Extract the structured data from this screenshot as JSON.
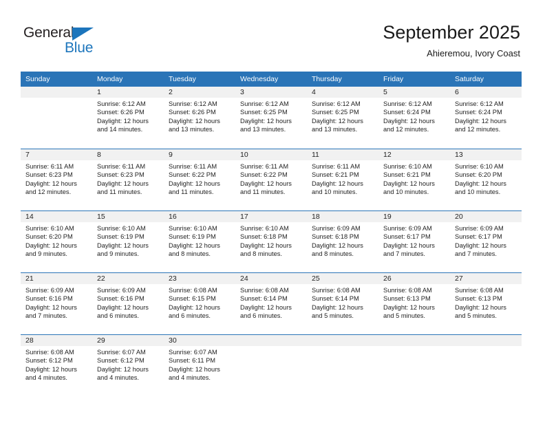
{
  "brand": {
    "name_part1": "General",
    "name_part2": "Blue",
    "accent_color": "#1c75bc"
  },
  "header": {
    "title": "September 2025",
    "subtitle": "Ahieremou, Ivory Coast"
  },
  "calendar": {
    "header_bg_color": "#2a74b7",
    "day_band_color": "#f1f1f1",
    "weekdays": [
      "Sunday",
      "Monday",
      "Tuesday",
      "Wednesday",
      "Thursday",
      "Friday",
      "Saturday"
    ],
    "weeks": [
      [
        {
          "day": "",
          "sunrise": "",
          "sunset": "",
          "daylight1": "",
          "daylight2": ""
        },
        {
          "day": "1",
          "sunrise": "Sunrise: 6:12 AM",
          "sunset": "Sunset: 6:26 PM",
          "daylight1": "Daylight: 12 hours",
          "daylight2": "and 14 minutes."
        },
        {
          "day": "2",
          "sunrise": "Sunrise: 6:12 AM",
          "sunset": "Sunset: 6:26 PM",
          "daylight1": "Daylight: 12 hours",
          "daylight2": "and 13 minutes."
        },
        {
          "day": "3",
          "sunrise": "Sunrise: 6:12 AM",
          "sunset": "Sunset: 6:25 PM",
          "daylight1": "Daylight: 12 hours",
          "daylight2": "and 13 minutes."
        },
        {
          "day": "4",
          "sunrise": "Sunrise: 6:12 AM",
          "sunset": "Sunset: 6:25 PM",
          "daylight1": "Daylight: 12 hours",
          "daylight2": "and 13 minutes."
        },
        {
          "day": "5",
          "sunrise": "Sunrise: 6:12 AM",
          "sunset": "Sunset: 6:24 PM",
          "daylight1": "Daylight: 12 hours",
          "daylight2": "and 12 minutes."
        },
        {
          "day": "6",
          "sunrise": "Sunrise: 6:12 AM",
          "sunset": "Sunset: 6:24 PM",
          "daylight1": "Daylight: 12 hours",
          "daylight2": "and 12 minutes."
        }
      ],
      [
        {
          "day": "7",
          "sunrise": "Sunrise: 6:11 AM",
          "sunset": "Sunset: 6:23 PM",
          "daylight1": "Daylight: 12 hours",
          "daylight2": "and 12 minutes."
        },
        {
          "day": "8",
          "sunrise": "Sunrise: 6:11 AM",
          "sunset": "Sunset: 6:23 PM",
          "daylight1": "Daylight: 12 hours",
          "daylight2": "and 11 minutes."
        },
        {
          "day": "9",
          "sunrise": "Sunrise: 6:11 AM",
          "sunset": "Sunset: 6:22 PM",
          "daylight1": "Daylight: 12 hours",
          "daylight2": "and 11 minutes."
        },
        {
          "day": "10",
          "sunrise": "Sunrise: 6:11 AM",
          "sunset": "Sunset: 6:22 PM",
          "daylight1": "Daylight: 12 hours",
          "daylight2": "and 11 minutes."
        },
        {
          "day": "11",
          "sunrise": "Sunrise: 6:11 AM",
          "sunset": "Sunset: 6:21 PM",
          "daylight1": "Daylight: 12 hours",
          "daylight2": "and 10 minutes."
        },
        {
          "day": "12",
          "sunrise": "Sunrise: 6:10 AM",
          "sunset": "Sunset: 6:21 PM",
          "daylight1": "Daylight: 12 hours",
          "daylight2": "and 10 minutes."
        },
        {
          "day": "13",
          "sunrise": "Sunrise: 6:10 AM",
          "sunset": "Sunset: 6:20 PM",
          "daylight1": "Daylight: 12 hours",
          "daylight2": "and 10 minutes."
        }
      ],
      [
        {
          "day": "14",
          "sunrise": "Sunrise: 6:10 AM",
          "sunset": "Sunset: 6:20 PM",
          "daylight1": "Daylight: 12 hours",
          "daylight2": "and 9 minutes."
        },
        {
          "day": "15",
          "sunrise": "Sunrise: 6:10 AM",
          "sunset": "Sunset: 6:19 PM",
          "daylight1": "Daylight: 12 hours",
          "daylight2": "and 9 minutes."
        },
        {
          "day": "16",
          "sunrise": "Sunrise: 6:10 AM",
          "sunset": "Sunset: 6:19 PM",
          "daylight1": "Daylight: 12 hours",
          "daylight2": "and 8 minutes."
        },
        {
          "day": "17",
          "sunrise": "Sunrise: 6:10 AM",
          "sunset": "Sunset: 6:18 PM",
          "daylight1": "Daylight: 12 hours",
          "daylight2": "and 8 minutes."
        },
        {
          "day": "18",
          "sunrise": "Sunrise: 6:09 AM",
          "sunset": "Sunset: 6:18 PM",
          "daylight1": "Daylight: 12 hours",
          "daylight2": "and 8 minutes."
        },
        {
          "day": "19",
          "sunrise": "Sunrise: 6:09 AM",
          "sunset": "Sunset: 6:17 PM",
          "daylight1": "Daylight: 12 hours",
          "daylight2": "and 7 minutes."
        },
        {
          "day": "20",
          "sunrise": "Sunrise: 6:09 AM",
          "sunset": "Sunset: 6:17 PM",
          "daylight1": "Daylight: 12 hours",
          "daylight2": "and 7 minutes."
        }
      ],
      [
        {
          "day": "21",
          "sunrise": "Sunrise: 6:09 AM",
          "sunset": "Sunset: 6:16 PM",
          "daylight1": "Daylight: 12 hours",
          "daylight2": "and 7 minutes."
        },
        {
          "day": "22",
          "sunrise": "Sunrise: 6:09 AM",
          "sunset": "Sunset: 6:16 PM",
          "daylight1": "Daylight: 12 hours",
          "daylight2": "and 6 minutes."
        },
        {
          "day": "23",
          "sunrise": "Sunrise: 6:08 AM",
          "sunset": "Sunset: 6:15 PM",
          "daylight1": "Daylight: 12 hours",
          "daylight2": "and 6 minutes."
        },
        {
          "day": "24",
          "sunrise": "Sunrise: 6:08 AM",
          "sunset": "Sunset: 6:14 PM",
          "daylight1": "Daylight: 12 hours",
          "daylight2": "and 6 minutes."
        },
        {
          "day": "25",
          "sunrise": "Sunrise: 6:08 AM",
          "sunset": "Sunset: 6:14 PM",
          "daylight1": "Daylight: 12 hours",
          "daylight2": "and 5 minutes."
        },
        {
          "day": "26",
          "sunrise": "Sunrise: 6:08 AM",
          "sunset": "Sunset: 6:13 PM",
          "daylight1": "Daylight: 12 hours",
          "daylight2": "and 5 minutes."
        },
        {
          "day": "27",
          "sunrise": "Sunrise: 6:08 AM",
          "sunset": "Sunset: 6:13 PM",
          "daylight1": "Daylight: 12 hours",
          "daylight2": "and 5 minutes."
        }
      ],
      [
        {
          "day": "28",
          "sunrise": "Sunrise: 6:08 AM",
          "sunset": "Sunset: 6:12 PM",
          "daylight1": "Daylight: 12 hours",
          "daylight2": "and 4 minutes."
        },
        {
          "day": "29",
          "sunrise": "Sunrise: 6:07 AM",
          "sunset": "Sunset: 6:12 PM",
          "daylight1": "Daylight: 12 hours",
          "daylight2": "and 4 minutes."
        },
        {
          "day": "30",
          "sunrise": "Sunrise: 6:07 AM",
          "sunset": "Sunset: 6:11 PM",
          "daylight1": "Daylight: 12 hours",
          "daylight2": "and 4 minutes."
        },
        {
          "day": "",
          "sunrise": "",
          "sunset": "",
          "daylight1": "",
          "daylight2": ""
        },
        {
          "day": "",
          "sunrise": "",
          "sunset": "",
          "daylight1": "",
          "daylight2": ""
        },
        {
          "day": "",
          "sunrise": "",
          "sunset": "",
          "daylight1": "",
          "daylight2": ""
        },
        {
          "day": "",
          "sunrise": "",
          "sunset": "",
          "daylight1": "",
          "daylight2": ""
        }
      ]
    ]
  }
}
